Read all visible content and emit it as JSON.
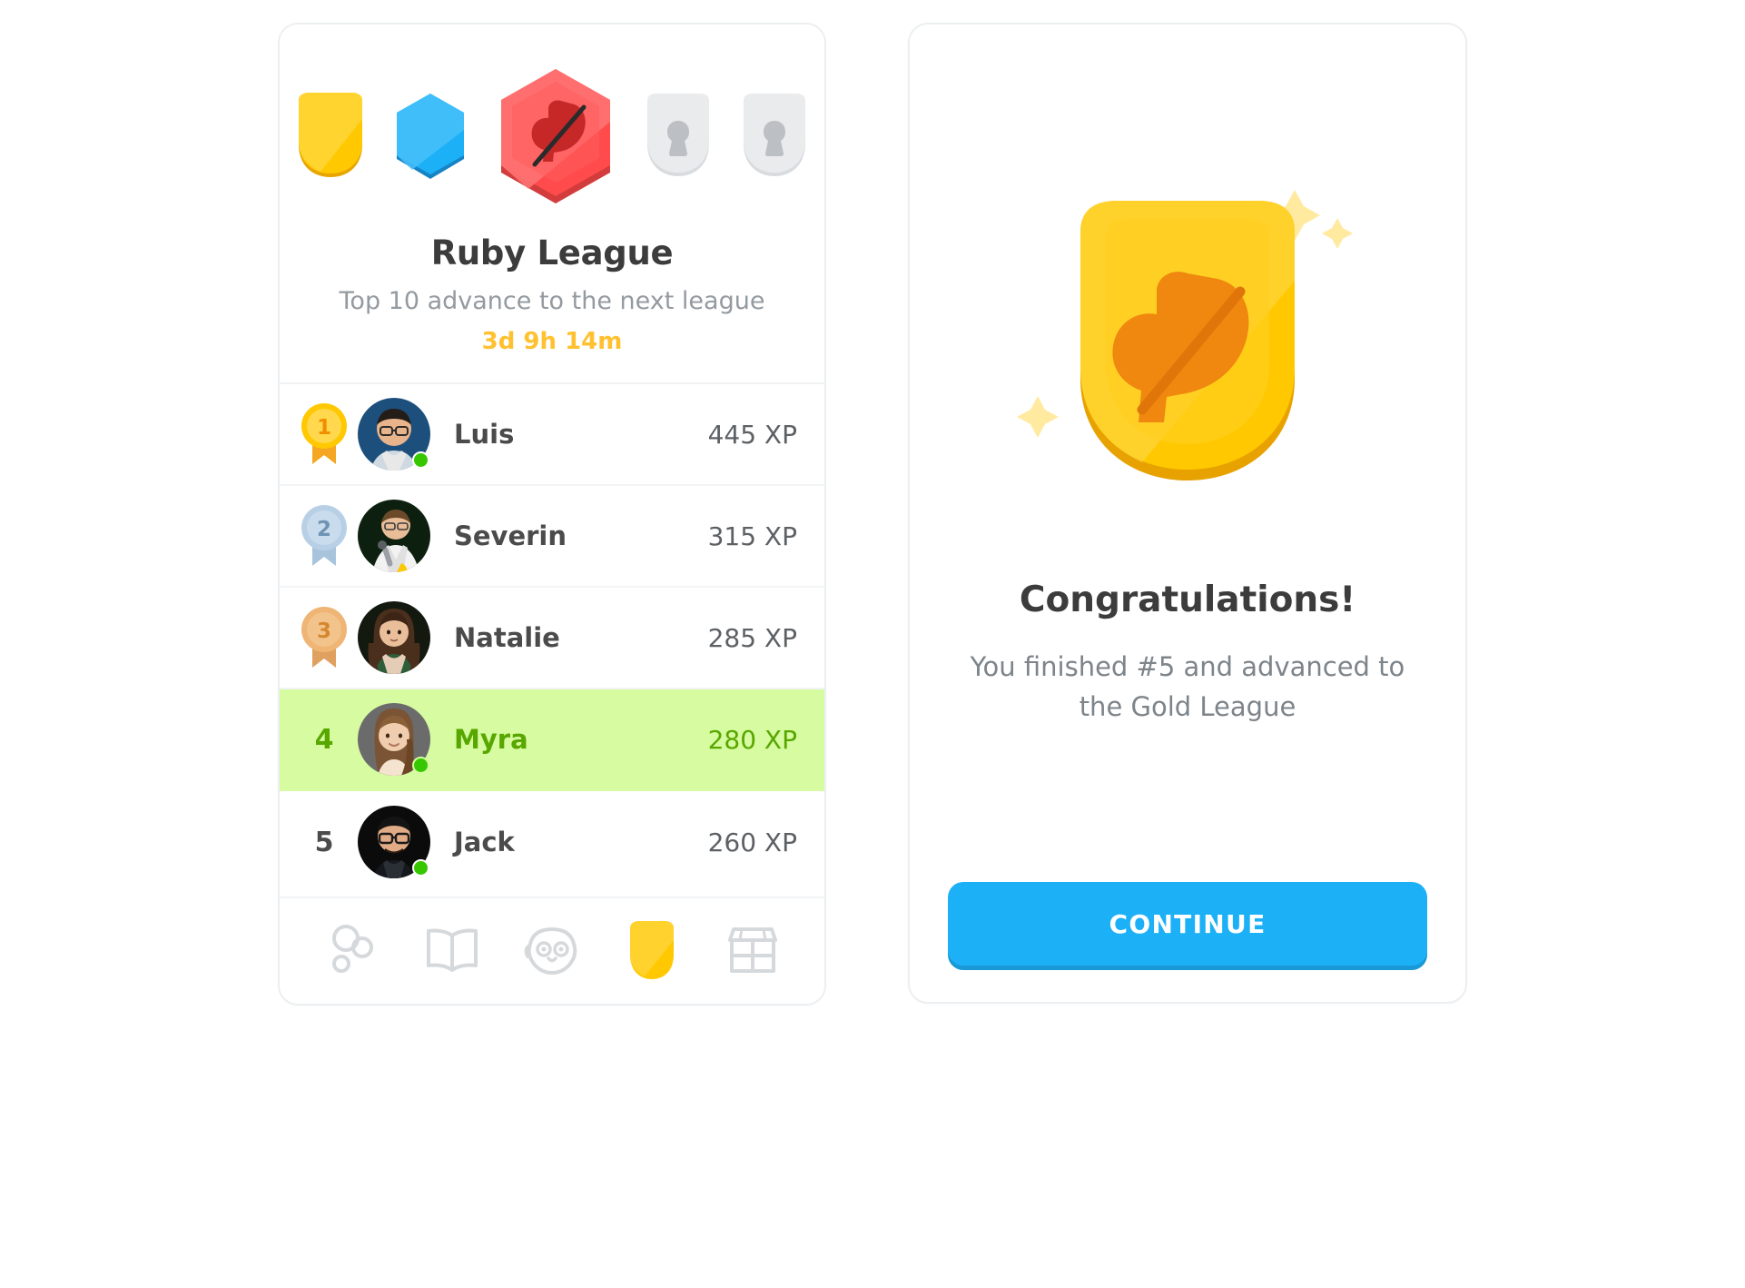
{
  "league": {
    "title": "Ruby League",
    "subtitle": "Top 10 advance to the next league",
    "timer": "3d 9h 14m",
    "badges": [
      {
        "name": "gold-shield-badge",
        "state": "unlocked",
        "shape": "shield",
        "color": "#ffc800"
      },
      {
        "name": "sapphire-hexagon-badge",
        "state": "unlocked",
        "shape": "hexagon",
        "color": "#1cb0f6"
      },
      {
        "name": "ruby-hexagon-badge",
        "state": "current",
        "shape": "hexagon",
        "color": "#ff4b4b"
      },
      {
        "name": "locked-badge-1",
        "state": "locked",
        "shape": "shield",
        "color": "#e5e5e5"
      },
      {
        "name": "locked-badge-2",
        "state": "locked",
        "shape": "shield",
        "color": "#e5e5e5"
      }
    ],
    "rows": [
      {
        "rank": "1",
        "name": "Luis",
        "xp": "445 XP",
        "medal": "gold",
        "online": true,
        "highlight": false
      },
      {
        "rank": "2",
        "name": "Severin",
        "xp": "315 XP",
        "medal": "silver",
        "online": false,
        "highlight": false
      },
      {
        "rank": "3",
        "name": "Natalie",
        "xp": "285 XP",
        "medal": "bronze",
        "online": false,
        "highlight": false
      },
      {
        "rank": "4",
        "name": "Myra",
        "xp": "280 XP",
        "medal": "none",
        "online": true,
        "highlight": true
      },
      {
        "rank": "5",
        "name": "Jack",
        "xp": "260 XP",
        "medal": "none",
        "online": true,
        "highlight": false
      }
    ],
    "nav": [
      {
        "icon": "friends-icon",
        "active": false
      },
      {
        "icon": "book-icon",
        "active": false
      },
      {
        "icon": "owl-mascot-icon",
        "active": false
      },
      {
        "icon": "shield-league-icon",
        "active": true
      },
      {
        "icon": "shop-icon",
        "active": false
      }
    ]
  },
  "congrats": {
    "icon": "gold-feather-shield-icon",
    "title": "Congratulations!",
    "message": "You finished #5 and advanced to the Gold League",
    "button_label": "CONTINUE"
  },
  "colors": {
    "gold": "#ffc800",
    "blue": "#1cb0f6",
    "ruby": "#ff4b4b",
    "locked_gray": "#e5e5e5",
    "highlight_green": "#d7fba0",
    "green_text": "#58a700",
    "timer_orange": "#ffc130",
    "body_text": "#4b4b4b",
    "muted_text": "#939aa0"
  }
}
